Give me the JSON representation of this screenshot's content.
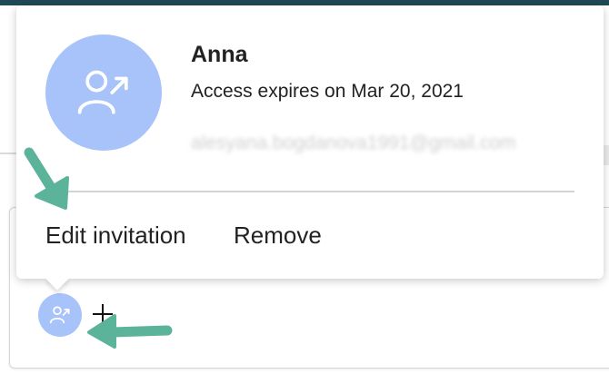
{
  "popover": {
    "name": "Anna",
    "status": "Access expires on Mar 20, 2021",
    "email": "alesyana.bogdanova1991@gmail.com",
    "actions": {
      "edit": "Edit invitation",
      "remove": "Remove"
    }
  },
  "icons": {
    "avatar": "person-arrow-icon",
    "cursor": "crosshair-cursor-icon",
    "annotation": "green-arrow-icon"
  },
  "colors": {
    "avatar_bg": "#a7c3f9",
    "annotation_arrow": "#5bb39a",
    "top_bar": "#1f4a55"
  }
}
